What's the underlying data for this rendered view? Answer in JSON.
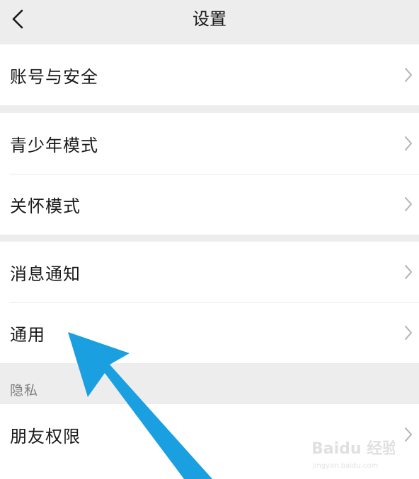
{
  "nav": {
    "back_icon": "chevron-left-icon",
    "title": "设置"
  },
  "groups": [
    {
      "items": [
        {
          "label": "账号与安全"
        }
      ]
    },
    {
      "items": [
        {
          "label": "青少年模式"
        },
        {
          "label": "关怀模式"
        }
      ]
    },
    {
      "items": [
        {
          "label": "消息通知"
        },
        {
          "label": "通用"
        }
      ]
    }
  ],
  "privacy": {
    "header": "隐私",
    "items": [
      {
        "label": "朋友权限"
      }
    ]
  },
  "annotation": {
    "arrow_color": "#1a9fe0",
    "target": "通用"
  },
  "watermark": {
    "brand": "Baidu 经验",
    "url": "jingyan.baidu.com"
  },
  "colors": {
    "background": "#ededed",
    "card": "#ffffff",
    "text": "#191919",
    "secondary_text": "#7f7f7f",
    "chevron": "#b2b2b2"
  }
}
